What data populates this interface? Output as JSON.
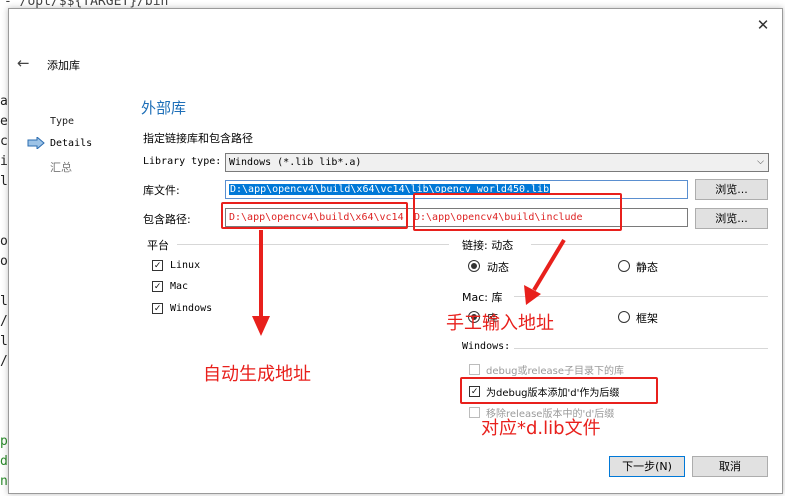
{
  "background_editor": {
    "top_line": "- /opt/$${TARGET}/bin",
    "left_chars": [
      "a",
      "e",
      "c",
      "i",
      "l",
      "",
      "",
      "o",
      "o",
      "",
      "l",
      "/",
      "l",
      "/",
      "",
      "",
      "",
      "p",
      "d",
      "n"
    ]
  },
  "dialog": {
    "header_title": "添加库",
    "nav": {
      "items": [
        {
          "label": "Type"
        },
        {
          "label": "Details"
        },
        {
          "label": "汇总"
        }
      ]
    },
    "section_title": "外部库",
    "section_subtitle": "指定链接库和包含路径",
    "library_type": {
      "label": "Library type:",
      "value": "Windows (*.lib lib*.a)"
    },
    "library_file": {
      "label": "库文件:",
      "value": "D:\\app\\opencv4\\build\\x64\\vc14\\lib\\opencv_world450.lib",
      "browse": "浏览..."
    },
    "include_path": {
      "label": "包含路径:",
      "value_auto": "D:\\app\\opencv4\\build\\x64\\vc14",
      "value_manual": "D:\\app\\opencv4\\build\\include",
      "browse": "浏览..."
    },
    "platform": {
      "title": "平台",
      "options": [
        {
          "label": "Linux",
          "checked": true
        },
        {
          "label": "Mac",
          "checked": true
        },
        {
          "label": "Windows",
          "checked": true
        }
      ]
    },
    "linkage": {
      "title": "链接: 动态",
      "dynamic": "动态",
      "static": "静态"
    },
    "mac": {
      "title": "Mac: 库",
      "library": "库",
      "framework": "框架"
    },
    "windows": {
      "title": "Windows:",
      "opt1": "debug或release子目录下的库",
      "opt2": "为debug版本添加'd'作为后缀",
      "opt3": "移除release版本中的'd'后缀"
    },
    "buttons": {
      "next": "下一步(N)",
      "cancel": "取消"
    }
  },
  "annotations": {
    "auto_address": "自动生成地址",
    "manual_address": "手工输入地址",
    "dlib_file": "对应*d.lib文件"
  },
  "colors": {
    "accent": "#1e6fb8",
    "annotation": "#e8201c",
    "selection": "#0078d7"
  }
}
